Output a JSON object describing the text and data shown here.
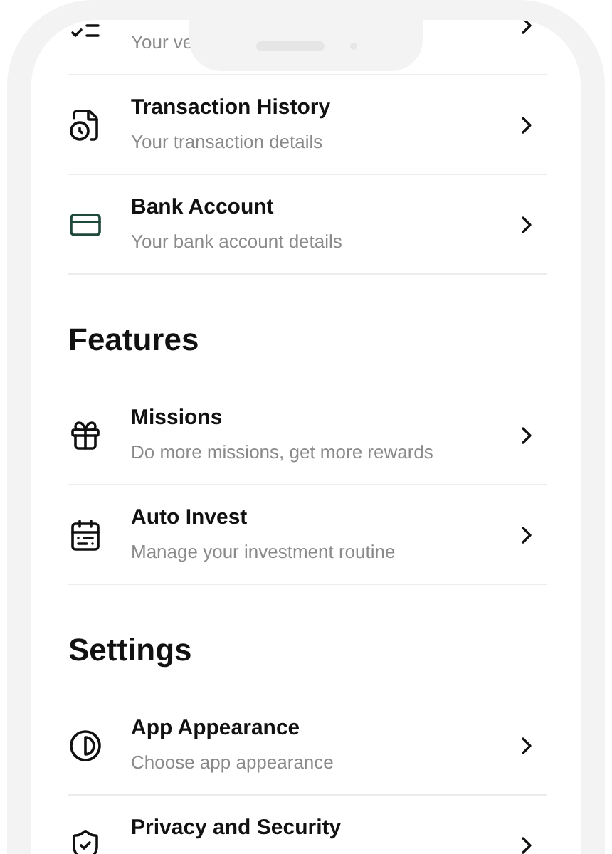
{
  "sections": [
    {
      "items": [
        {
          "subtitle": "Your ve"
        },
        {
          "title": "Transaction History",
          "subtitle": "Your transaction details"
        },
        {
          "title": "Bank Account",
          "subtitle": "Your bank account details"
        }
      ]
    },
    {
      "heading": "Features",
      "items": [
        {
          "title": "Missions",
          "subtitle": "Do more missions, get more rewards"
        },
        {
          "title": "Auto Invest",
          "subtitle": "Manage your investment routine"
        }
      ]
    },
    {
      "heading": "Settings",
      "items": [
        {
          "title": "App Appearance",
          "subtitle": "Choose app appearance"
        },
        {
          "title": "Privacy and Security"
        }
      ]
    }
  ]
}
